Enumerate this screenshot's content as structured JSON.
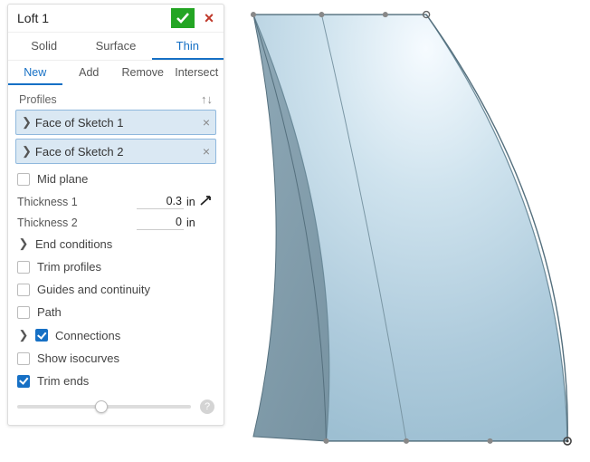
{
  "header": {
    "title": "Loft 1"
  },
  "tabs": {
    "solid": "Solid",
    "surface": "Surface",
    "thin": "Thin",
    "active": "thin"
  },
  "subtabs": {
    "new": "New",
    "add": "Add",
    "remove": "Remove",
    "intersect": "Intersect",
    "active": "new"
  },
  "profiles": {
    "label": "Profiles",
    "items": [
      {
        "label": "Face of Sketch 1"
      },
      {
        "label": "Face of Sketch 2"
      }
    ]
  },
  "options": {
    "mid_plane": "Mid plane",
    "thickness1_label": "Thickness 1",
    "thickness1_value": "0.3",
    "thickness1_unit": "in",
    "thickness2_label": "Thickness 2",
    "thickness2_value": "0",
    "thickness2_unit": "in",
    "end_conditions": "End conditions",
    "trim_profiles": "Trim profiles",
    "guides": "Guides and continuity",
    "path": "Path",
    "connections": "Connections",
    "show_isocurves": "Show isocurves",
    "trim_ends": "Trim ends"
  },
  "slider": {
    "position_pct": 45
  },
  "icons": {
    "reorder": "↑↓",
    "chevron": "❯",
    "close": "×",
    "help": "?"
  }
}
